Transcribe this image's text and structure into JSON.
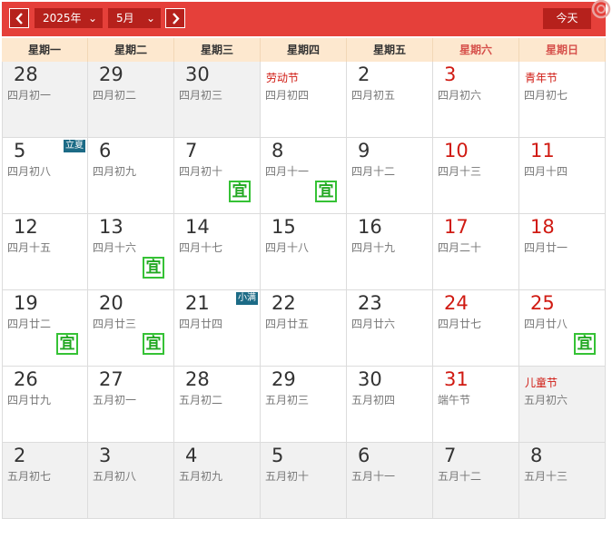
{
  "toolbar": {
    "prev_icon": "chevron-left-icon",
    "next_icon": "chevron-right-icon",
    "year_value": "2025年",
    "month_value": "5月",
    "today_label": "今天",
    "accent_color": "#e5403a",
    "button_color": "#b6211c"
  },
  "weekdays": [
    "星期一",
    "星期二",
    "星期三",
    "星期四",
    "星期五",
    "星期六",
    "星期日"
  ],
  "cells": [
    {
      "day": "28",
      "lunar": "四月初一",
      "gray": true
    },
    {
      "day": "29",
      "lunar": "四月初二",
      "gray": true
    },
    {
      "day": "30",
      "lunar": "四月初三",
      "gray": true
    },
    {
      "fest": "劳动节",
      "lunar": "四月初四"
    },
    {
      "day": "2",
      "lunar": "四月初五"
    },
    {
      "day": "3",
      "lunar": "四月初六",
      "red": true
    },
    {
      "fest": "青年节",
      "lunar": "四月初七"
    },
    {
      "day": "5",
      "lunar": "四月初八",
      "term": "立夏"
    },
    {
      "day": "6",
      "lunar": "四月初九"
    },
    {
      "day": "7",
      "lunar": "四月初十",
      "yi": "宜"
    },
    {
      "day": "8",
      "lunar": "四月十一",
      "yi": "宜"
    },
    {
      "day": "9",
      "lunar": "四月十二"
    },
    {
      "day": "10",
      "lunar": "四月十三",
      "red": true
    },
    {
      "day": "11",
      "lunar": "四月十四",
      "red": true
    },
    {
      "day": "12",
      "lunar": "四月十五"
    },
    {
      "day": "13",
      "lunar": "四月十六",
      "yi": "宜"
    },
    {
      "day": "14",
      "lunar": "四月十七"
    },
    {
      "day": "15",
      "lunar": "四月十八"
    },
    {
      "day": "16",
      "lunar": "四月十九"
    },
    {
      "day": "17",
      "lunar": "四月二十",
      "red": true
    },
    {
      "day": "18",
      "lunar": "四月廿一",
      "red": true
    },
    {
      "day": "19",
      "lunar": "四月廿二",
      "yi": "宜"
    },
    {
      "day": "20",
      "lunar": "四月廿三",
      "yi": "宜"
    },
    {
      "day": "21",
      "lunar": "四月廿四",
      "term": "小满"
    },
    {
      "day": "22",
      "lunar": "四月廿五"
    },
    {
      "day": "23",
      "lunar": "四月廿六"
    },
    {
      "day": "24",
      "lunar": "四月廿七",
      "red": true
    },
    {
      "day": "25",
      "lunar": "四月廿八",
      "red": true,
      "yi": "宜"
    },
    {
      "day": "26",
      "lunar": "四月廿九"
    },
    {
      "day": "27",
      "lunar": "五月初一"
    },
    {
      "day": "28",
      "lunar": "五月初二"
    },
    {
      "day": "29",
      "lunar": "五月初三"
    },
    {
      "day": "30",
      "lunar": "五月初四"
    },
    {
      "day": "31",
      "lunar": "端午节",
      "red": true
    },
    {
      "fest": "儿童节",
      "lunar": "五月初六",
      "gray": true
    },
    {
      "day": "2",
      "lunar": "五月初七",
      "gray": true
    },
    {
      "day": "3",
      "lunar": "五月初八",
      "gray": true
    },
    {
      "day": "4",
      "lunar": "五月初九",
      "gray": true
    },
    {
      "day": "5",
      "lunar": "五月初十",
      "gray": true
    },
    {
      "day": "6",
      "lunar": "五月十一",
      "gray": true
    },
    {
      "day": "7",
      "lunar": "五月十二",
      "gray": true
    },
    {
      "day": "8",
      "lunar": "五月十三",
      "gray": true
    }
  ]
}
